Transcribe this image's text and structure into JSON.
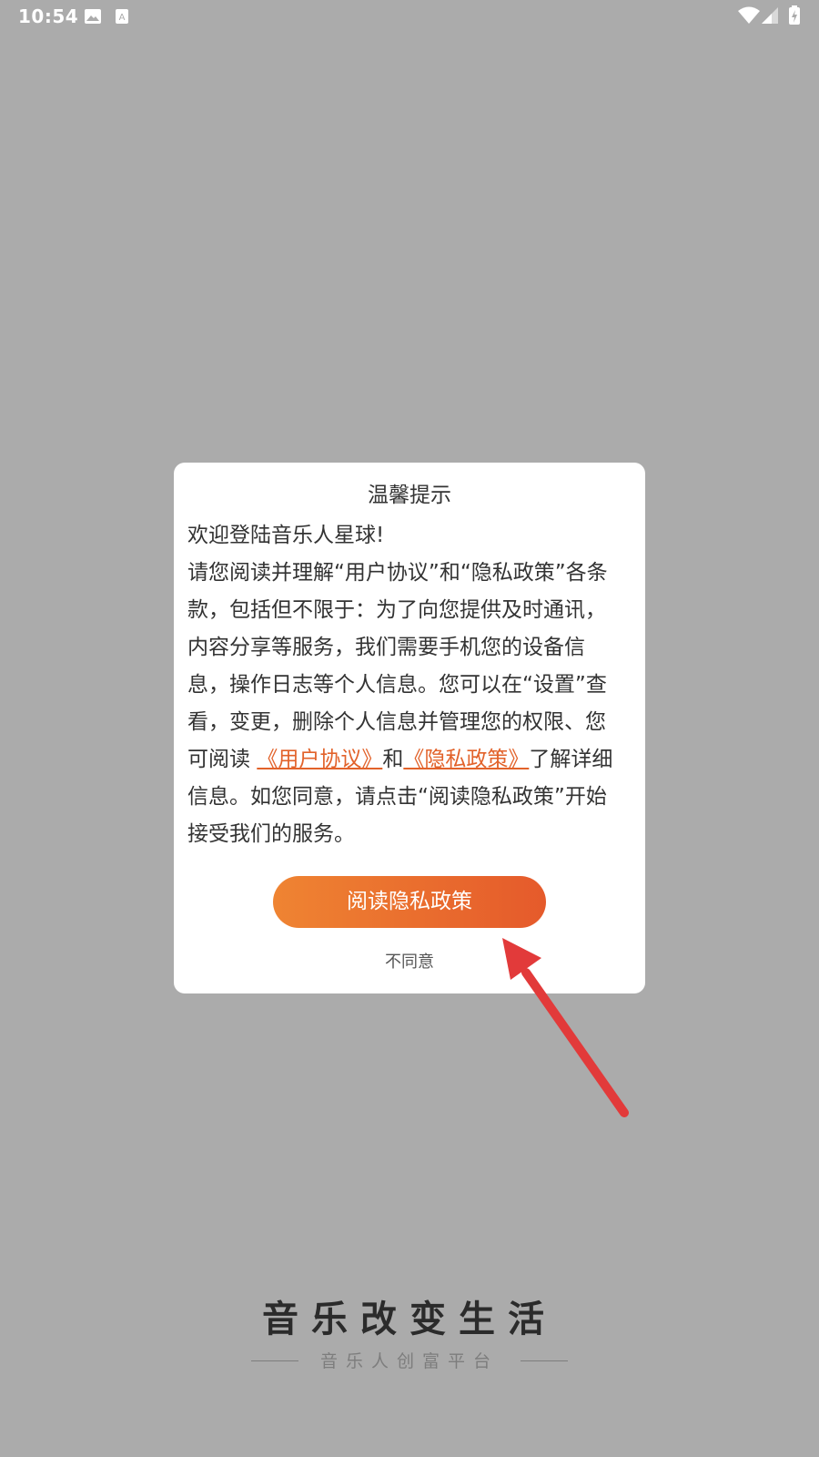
{
  "status_bar": {
    "time": "10:54",
    "icons": [
      "image-icon",
      "a-keyboard-icon",
      "wifi-icon",
      "signal-icon",
      "battery-charging-icon"
    ]
  },
  "dialog": {
    "title": "温馨提示",
    "body_lines": [
      "欢迎登陆音乐人星球!",
      "请您阅读并理解“用户协议”和“隐私政策”各条",
      "款，包括但不限于：为了向您提供及时通讯，",
      "内容分享等服务，我们需要手机您的设备信",
      "息，操作日志等个人信息。您可以在“设置”查",
      "看，变更，删除个人信息并管理您的权限、您"
    ],
    "link_line": {
      "prefix": "可阅读 ",
      "user_agreement_link": "《用户协议》",
      "middle": "和",
      "privacy_policy_link": "《隐私政策》",
      "suffix": "了解详细"
    },
    "body_lines_after": [
      "信息。如您同意，请点击“阅读隐私政策”开始",
      "接受我们的服务。"
    ],
    "agree_button": "阅读隐私政策",
    "decline_button": "不同意"
  },
  "colors": {
    "overlay": "#ababab",
    "accent_start": "#ef8432",
    "accent_end": "#e55a2b",
    "link": "#e2622a",
    "annotation_arrow": "#e23a3a"
  },
  "footer": {
    "slogan": "音乐改变生活",
    "subtitle": "音乐人创富平台"
  }
}
